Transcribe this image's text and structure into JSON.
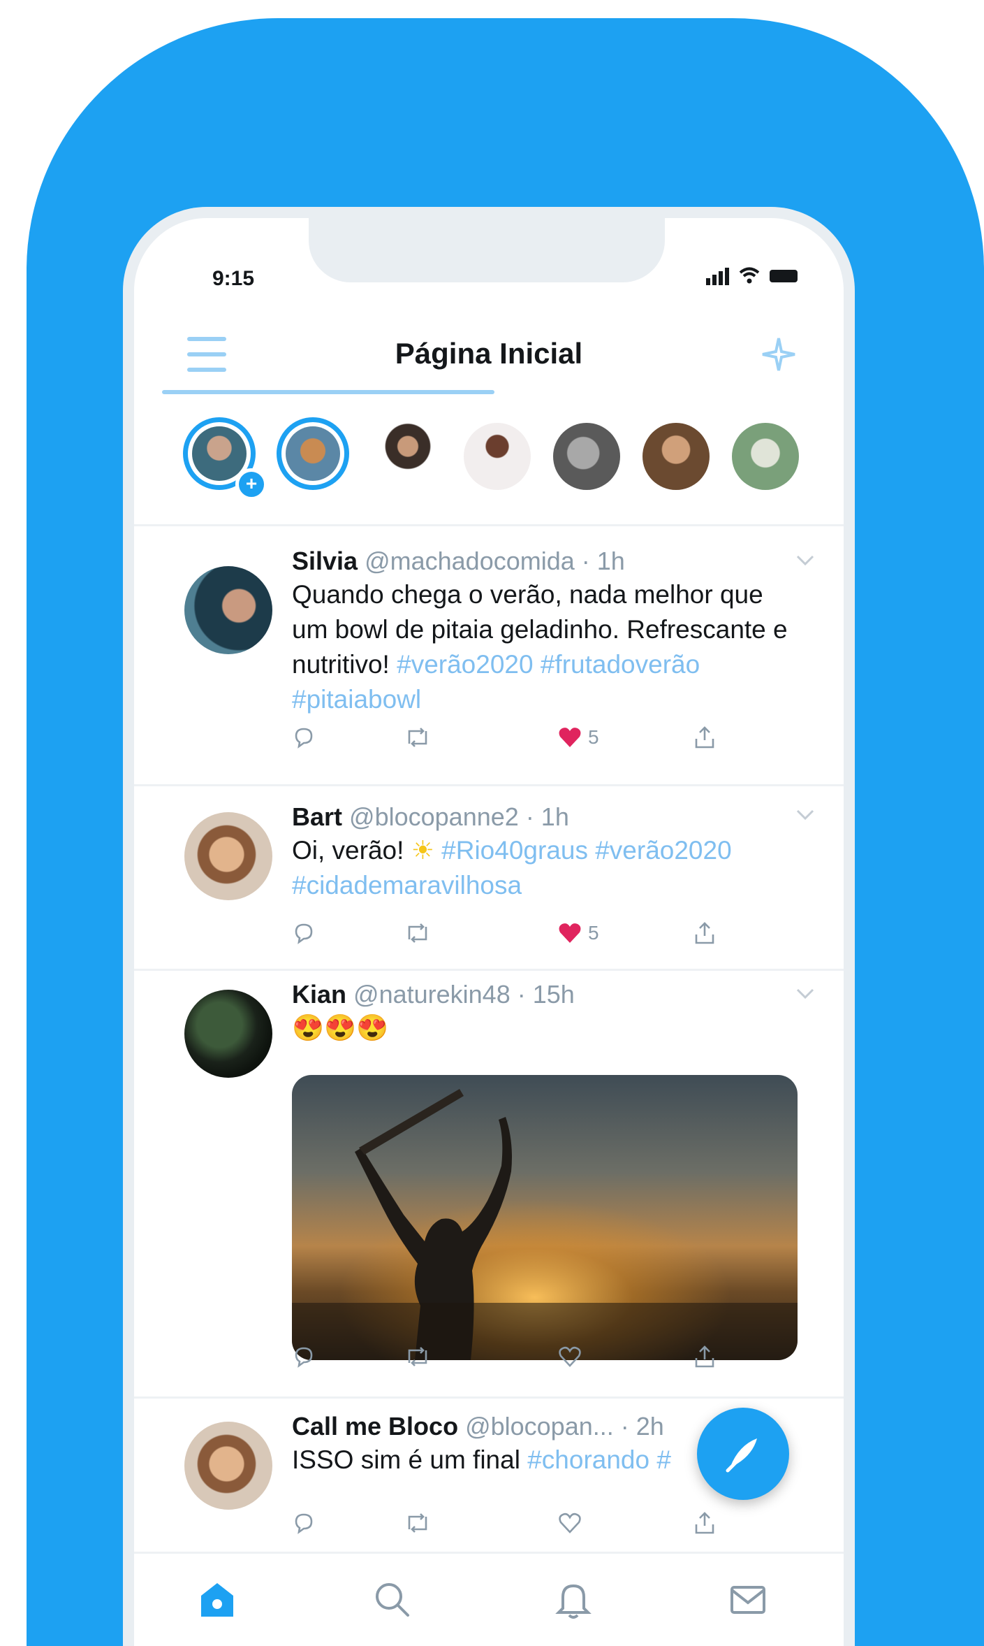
{
  "status_bar": {
    "time": "9:15"
  },
  "header": {
    "title": "Página Inicial"
  },
  "fleets": [
    {
      "name": "fleet-own",
      "colors": [
        "#3d6b7d",
        "#c9a38c"
      ]
    },
    {
      "name": "fleet-2",
      "colors": [
        "#5b87a6",
        "#c98b52"
      ]
    },
    {
      "name": "fleet-3",
      "colors": [
        "#3a2e28",
        "#c89a7a"
      ]
    },
    {
      "name": "fleet-4",
      "colors": [
        "#f2eeee",
        "#6b3e2e"
      ]
    },
    {
      "name": "fleet-5",
      "colors": [
        "#5a5a5a",
        "#a8a8a8"
      ]
    },
    {
      "name": "fleet-6",
      "colors": [
        "#6b4a30",
        "#d0a07a"
      ]
    },
    {
      "name": "fleet-7",
      "colors": [
        "#7aa07a",
        "#e0e4d8"
      ]
    }
  ],
  "tweets": [
    {
      "name": "Silvia",
      "handle": "@machadocomida",
      "time": "· 1h",
      "text": "Quando chega o verão, nada melhor que um bowl de pitaia geladinho. Refrescante e nutritivo!",
      "hashtags": "#verão2020 #frutadoverão #pitaiabowl",
      "likes": "5",
      "liked": true
    },
    {
      "name": "Bart",
      "handle": "@blocopanne2",
      "time": "· 1h",
      "text": "Oi, verão!",
      "emoji": "☀",
      "hashtags": "#Rio40graus #verão2020 #cidademaravilhosa",
      "likes": "5",
      "liked": true
    },
    {
      "name": "Kian",
      "handle": "@naturekin48",
      "time": "· 15h",
      "emoji": "😍😍😍",
      "media": "sunset-photo"
    },
    {
      "name": "Call me Bloco",
      "handle": "@blocopan...",
      "time": "· 2h",
      "text": "ISSO sim é um final",
      "hashtags": "#chorando #"
    }
  ],
  "colors": {
    "brand": "#1da1f2",
    "like": "#e0245e",
    "text": "#14171a",
    "muted": "#8a9aa8",
    "hashtag": "#7fbef0"
  }
}
